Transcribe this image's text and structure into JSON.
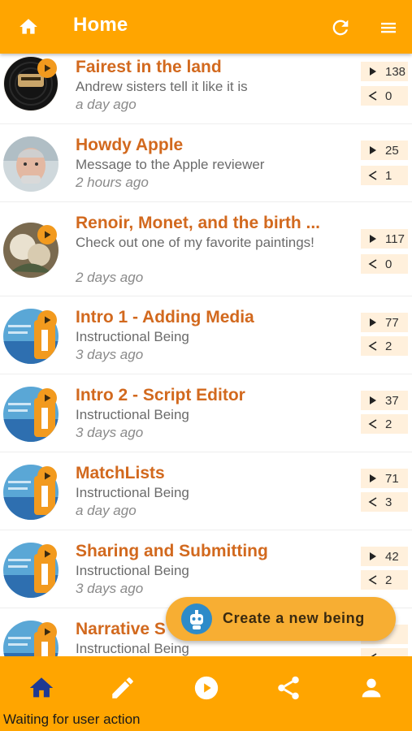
{
  "header": {
    "title": "Home",
    "home_icon": "home-icon",
    "refresh_icon": "refresh-icon",
    "menu_icon": "menu-icon"
  },
  "items": [
    {
      "title": "Fairest in the land",
      "subtitle": "Andrew sisters tell it like it is",
      "time": "a day ago",
      "plays": "138",
      "shares": "0",
      "avatar": "record"
    },
    {
      "title": "Howdy Apple",
      "subtitle": "Message to the Apple reviewer",
      "time": "2 hours ago",
      "plays": "25",
      "shares": "1",
      "avatar": "face"
    },
    {
      "title": "Renoir, Monet, and the birth ...",
      "subtitle": "Check out one of my favorite paintings!",
      "time": "2 days ago",
      "plays": "117",
      "shares": "0",
      "avatar": "painting"
    },
    {
      "title": "Intro 1 - Adding Media",
      "subtitle": "Instructional Being",
      "time": "3 days ago",
      "plays": "77",
      "shares": "2",
      "avatar": "info"
    },
    {
      "title": "Intro 2 - Script Editor",
      "subtitle": "Instructional Being",
      "time": "3 days ago",
      "plays": "37",
      "shares": "2",
      "avatar": "info"
    },
    {
      "title": "MatchLists",
      "subtitle": "Instructional Being",
      "time": "a day ago",
      "plays": "71",
      "shares": "3",
      "avatar": "info"
    },
    {
      "title": "Sharing and Submitting",
      "subtitle": "Instructional Being",
      "time": "3 days ago",
      "plays": "42",
      "shares": "2",
      "avatar": "info"
    },
    {
      "title": "Narrative S",
      "subtitle": "Instructional Being",
      "time": "",
      "plays": "",
      "shares": "",
      "avatar": "info"
    }
  ],
  "fab": {
    "label": "Create a new being",
    "icon": "robot-icon"
  },
  "bottom_nav": [
    "home-icon",
    "edit-icon",
    "play-icon",
    "share-icon",
    "person-icon"
  ],
  "status": "Waiting for user action",
  "colors": {
    "primary": "#FFA500",
    "title_text": "#D2691E",
    "stat_bg": "#FFF0DC",
    "fab": "#F7AE33",
    "active_nav": "#1F3A93"
  }
}
